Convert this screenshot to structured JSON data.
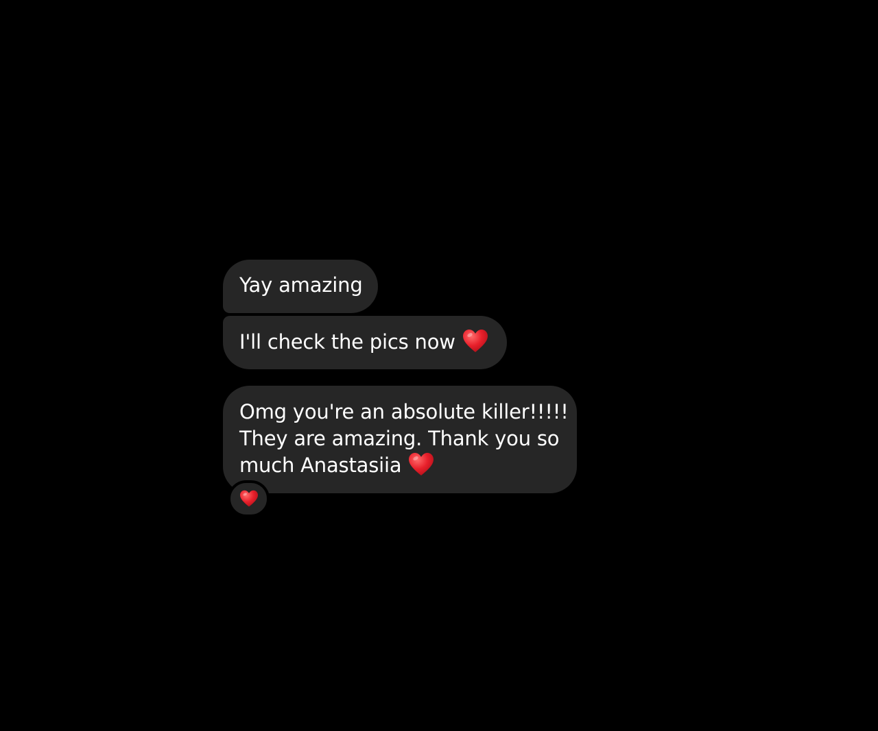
{
  "thread": {
    "messages": [
      {
        "text": "Yay amazing",
        "emoji": ""
      },
      {
        "text": "I'll check the pics now",
        "emoji": "red-heart"
      },
      {
        "lines": [
          "Omg you're an absolute killer!!!!!",
          "They are amazing. Thank you so",
          "much Anastasiia"
        ],
        "emoji": "red-heart",
        "reaction": "red-heart"
      }
    ]
  },
  "colors": {
    "background": "#000000",
    "bubble": "#262626",
    "text": "#ffffff",
    "heart": "#e8202b"
  }
}
